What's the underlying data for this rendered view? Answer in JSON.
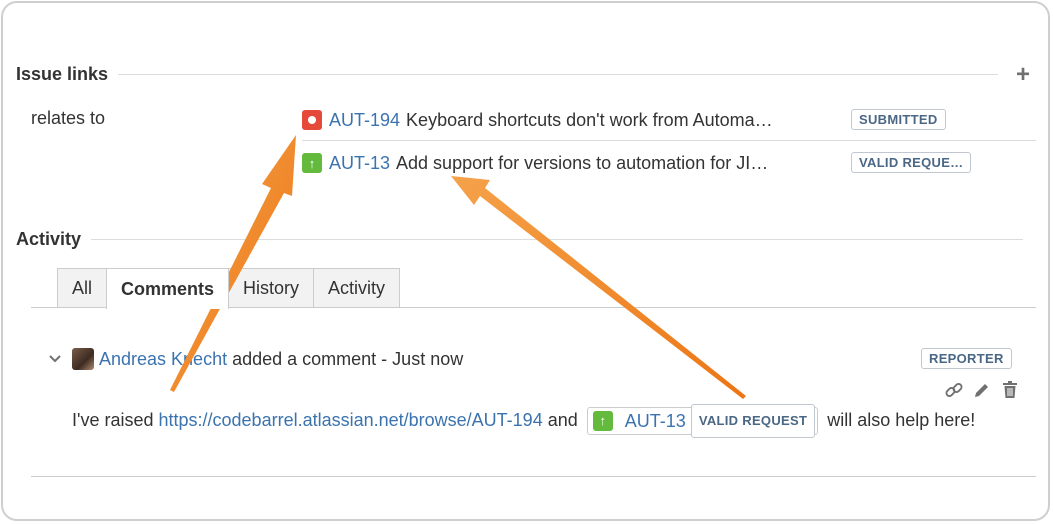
{
  "issue_links": {
    "title": "Issue links",
    "add_icon": "plus-icon",
    "relation": "relates to",
    "links": [
      {
        "type_icon": "bug-icon",
        "key": "AUT-194",
        "summary": "Keyboard shortcuts don't work from Automa…",
        "status": "SUBMITTED"
      },
      {
        "type_icon": "improvement-icon",
        "key": "AUT-13",
        "summary": "Add support for versions to automation for JI…",
        "status": "VALID REQUE…"
      }
    ]
  },
  "activity": {
    "title": "Activity",
    "tabs": [
      "All",
      "Comments",
      "History",
      "Activity"
    ],
    "active_tab": "Comments"
  },
  "comment": {
    "author": "Andreas Knecht",
    "meta": "added a comment - Just now",
    "badge": "REPORTER",
    "body_prefix": "I've raised",
    "url": "https://codebarrel.atlassian.net/browse/AUT-194",
    "body_mid": "and",
    "inline_issue_key": "AUT-13",
    "inline_issue_status": "VALID REQUEST",
    "body_suffix": "will also help here!",
    "actions": [
      "link-icon",
      "edit-icon",
      "delete-icon"
    ]
  },
  "colors": {
    "link": "#3b73af",
    "bug": "#e5493a",
    "improvement": "#63ba3c",
    "annotation_arrow": "#f07d1c"
  }
}
